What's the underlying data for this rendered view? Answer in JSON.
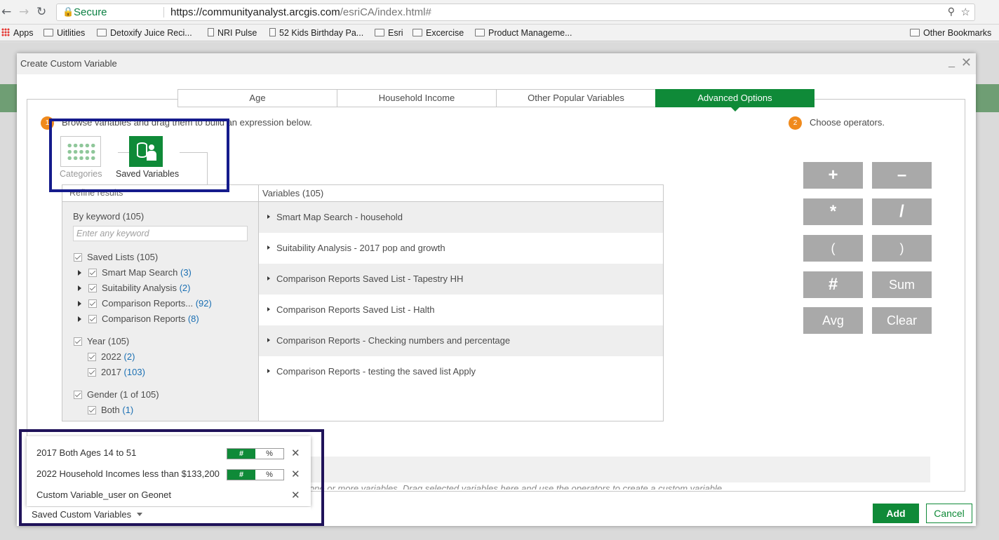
{
  "browser": {
    "secure_label": "Secure",
    "url_host": "https://communityanalyst.arcgis.com",
    "url_path": "/esriCA/index.html#"
  },
  "bookmarks": [
    {
      "label": "Apps",
      "icon": "apps-icon"
    },
    {
      "label": "Uitlities",
      "icon": "folder-icon"
    },
    {
      "label": "Detoxify Juice Reci...",
      "icon": "folder-icon"
    },
    {
      "label": "NRI Pulse",
      "icon": "page-icon"
    },
    {
      "label": "52 Kids Birthday Pa...",
      "icon": "page-icon"
    },
    {
      "label": "Esri",
      "icon": "folder-icon"
    },
    {
      "label": "Excercise",
      "icon": "folder-icon"
    },
    {
      "label": "Product Manageme...",
      "icon": "folder-icon"
    },
    {
      "label": "Other Bookmarks",
      "icon": "folder-icon"
    }
  ],
  "dialog": {
    "title": "Create Custom Variable",
    "tabs": [
      "Age",
      "Household Income",
      "Other Popular Variables",
      "Advanced Options"
    ],
    "active_tab": "Advanced Options",
    "step1_number": "1",
    "step1_text": "Browse variables and drag them to build an expression below.",
    "step2_number": "2",
    "step2_text": "Choose operators.",
    "categories_label": "Categories",
    "saved_variables_label": "Saved Variables",
    "refine": {
      "header": "Refine results",
      "keyword_label": "By keyword (105)",
      "keyword_placeholder": "Enter any keyword",
      "saved_lists_label": "Saved Lists (105)",
      "saved_lists": [
        {
          "label": "Smart Map Search",
          "count": "(3)"
        },
        {
          "label": "Suitability Analysis",
          "count": "(2)"
        },
        {
          "label": "Comparison Reports...",
          "count": "(92)"
        },
        {
          "label": "Comparison Reports",
          "count": "(8)"
        }
      ],
      "year_label": "Year (105)",
      "years": [
        {
          "label": "2022",
          "count": "(2)"
        },
        {
          "label": "2017",
          "count": "(103)"
        }
      ],
      "gender_label": "Gender (1 of 105)",
      "genders": [
        {
          "label": "Both",
          "count": "(1)"
        }
      ]
    },
    "variables": {
      "header": "Variables (105)",
      "rows": [
        "Smart Map Search - household",
        "Suitability Analysis - 2017 pop and growth",
        "Comparison Reports Saved List - Tapestry HH",
        "Comparison Reports Saved List - Halth",
        "Comparison Reports - Checking numbers and percentage",
        "Comparison Reports - testing the saved list Apply"
      ]
    },
    "operators": [
      "+",
      "–",
      "*",
      "/",
      "(",
      ")",
      "#",
      "Sum",
      "Avg",
      "Clear"
    ],
    "expression_hint": "ect one or more variables. Drag selected variables here and use the operators to create a custom variable.",
    "add_label": "Add",
    "cancel_label": "Cancel"
  },
  "saved_custom": {
    "items": [
      {
        "label": "2017 Both Ages 14 to 51",
        "hash": "#",
        "pct": "%",
        "has_toggle": true
      },
      {
        "label": "2022 Household Incomes less than $133,200",
        "hash": "#",
        "pct": "%",
        "has_toggle": true
      },
      {
        "label": "Custom Variable_user on Geonet",
        "has_toggle": false
      }
    ],
    "dropdown_label": "Saved Custom Variables"
  },
  "colors": {
    "brand_green": "#0f8a38",
    "step_orange": "#f08a1c",
    "operator_gray": "#a9a9a9",
    "highlight_blue": "#151b8c"
  }
}
